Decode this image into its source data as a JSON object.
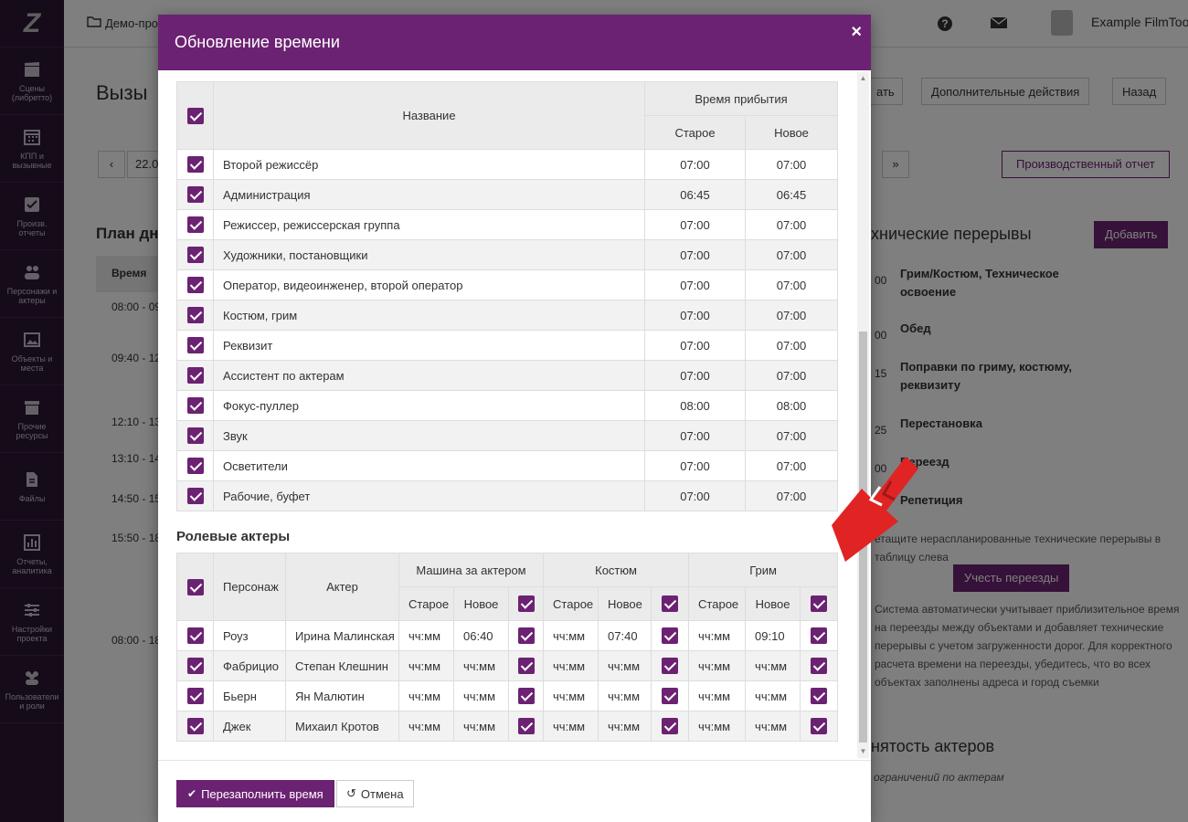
{
  "sidebar": {
    "logo": "Z",
    "items": [
      {
        "label": "Сцены (либретто)",
        "icon": "clapperboard-icon"
      },
      {
        "label": "КПП и вызывные",
        "icon": "calendar-icon"
      },
      {
        "label": "Произв. отчеты",
        "icon": "checkbox-icon"
      },
      {
        "label": "Персонажи и актеры",
        "icon": "users-icon"
      },
      {
        "label": "Объекты и места",
        "icon": "image-icon"
      },
      {
        "label": "Прочие ресурсы",
        "icon": "box-icon"
      },
      {
        "label": "Файлы",
        "icon": "file-icon"
      },
      {
        "label": "Отчеты, аналитика",
        "icon": "bar-chart-icon"
      },
      {
        "label": "Настройки проекта",
        "icon": "sliders-icon"
      },
      {
        "label": "Пользователи и роли",
        "icon": "users-group-icon"
      }
    ]
  },
  "topbar": {
    "project": "Демо-про",
    "user": "Example FilmTools"
  },
  "background": {
    "page_title": "Вызы",
    "actions_label": "Дополнительные действия",
    "back_label": "Назад",
    "partial_btn": "ать",
    "date": "22.0",
    "report_btn": "Производственный отчет",
    "plan_title": "План дн",
    "time_header": "Время",
    "times": [
      "08:00 - 09",
      "09:40 - 12",
      "12:10 - 13",
      "13:10 - 14",
      "14:50 - 15",
      "15:50 - 18",
      "08:00 - 18"
    ],
    "breaks_title": "хнические перерывы",
    "add_btn": "Добавить",
    "breaks": [
      {
        "time": "00",
        "name": "Грим/Костюм, Техническое освоение"
      },
      {
        "time": "00",
        "name": "Обед"
      },
      {
        "time": "15",
        "name": "Поправки по гриму, костюму, реквизиту"
      },
      {
        "time": "25",
        "name": "Перестановка"
      },
      {
        "time": "00",
        "name": "Переезд"
      },
      {
        "time": "",
        "name": "Репетиция"
      }
    ],
    "drag_hint": "етащите нераспланированные технические перерывы в таблицу слева",
    "travel_btn": "Учесть переезды",
    "travel_note": "Система автоматически учитывает приблизительное время на переезды между объектами и добавляет технические перерывы с учетом загруженности дорог. Для корректного расчета времени на переезды, убедитесь, что во всех объектах заполнены адреса и город съемки",
    "actors_busy": "нятость актеров",
    "actors_limits": "ограничений по актерам"
  },
  "modal": {
    "title": "Обновление времени",
    "close": "×",
    "crew_table": {
      "col_name": "Название",
      "col_arrival": "Время прибытия",
      "col_old": "Старое",
      "col_new": "Новое",
      "rows": [
        {
          "name": "Второй режиссёр",
          "old": "07:00",
          "new": "07:00"
        },
        {
          "name": "Администрация",
          "old": "06:45",
          "new": "06:45"
        },
        {
          "name": "Режиссер, режиссерская группа",
          "old": "07:00",
          "new": "07:00"
        },
        {
          "name": "Художники, постановщики",
          "old": "07:00",
          "new": "07:00"
        },
        {
          "name": "Оператор, видеоинженер, второй оператор",
          "old": "07:00",
          "new": "07:00"
        },
        {
          "name": "Костюм, грим",
          "old": "07:00",
          "new": "07:00"
        },
        {
          "name": "Реквизит",
          "old": "07:00",
          "new": "07:00"
        },
        {
          "name": "Ассистент по актерам",
          "old": "07:00",
          "new": "07:00"
        },
        {
          "name": "Фокус-пуллер",
          "old": "08:00",
          "new": "08:00"
        },
        {
          "name": "Звук",
          "old": "07:00",
          "new": "07:00"
        },
        {
          "name": "Осветители",
          "old": "07:00",
          "new": "07:00"
        },
        {
          "name": "Рабочие, буфет",
          "old": "07:00",
          "new": "07:00"
        }
      ]
    },
    "actors_section_title": "Ролевые актеры",
    "actors_table": {
      "col_character": "Персонаж",
      "col_actor": "Актер",
      "col_car": "Машина за актером",
      "col_costume": "Костюм",
      "col_makeup": "Грим",
      "col_old": "Старое",
      "col_new": "Новое",
      "rows": [
        {
          "character": "Роуз",
          "actor": "Ирина Малинская",
          "car_old": "чч:мм",
          "car_new": "06:40",
          "cos_old": "чч:мм",
          "cos_new": "07:40",
          "mk_old": "чч:мм",
          "mk_new": "09:10"
        },
        {
          "character": "Фабрицио",
          "actor": "Степан Клешнин",
          "car_old": "чч:мм",
          "car_new": "чч:мм",
          "cos_old": "чч:мм",
          "cos_new": "чч:мм",
          "mk_old": "чч:мм",
          "mk_new": "чч:мм"
        },
        {
          "character": "Бьерн",
          "actor": "Ян Малютин",
          "car_old": "чч:мм",
          "car_new": "чч:мм",
          "cos_old": "чч:мм",
          "cos_new": "чч:мм",
          "mk_old": "чч:мм",
          "mk_new": "чч:мм"
        },
        {
          "character": "Джек",
          "actor": "Михаил Кротов",
          "car_old": "чч:мм",
          "car_new": "чч:мм",
          "cos_old": "чч:мм",
          "cos_new": "чч:мм",
          "mk_old": "чч:мм",
          "mk_new": "чч:мм"
        }
      ]
    },
    "refill_button": "Перезаполнить время",
    "cancel_button": "Отмена"
  },
  "colors": {
    "brand": "#6c2272",
    "sidebar": "#2b1733",
    "arrow": "#e02424"
  }
}
